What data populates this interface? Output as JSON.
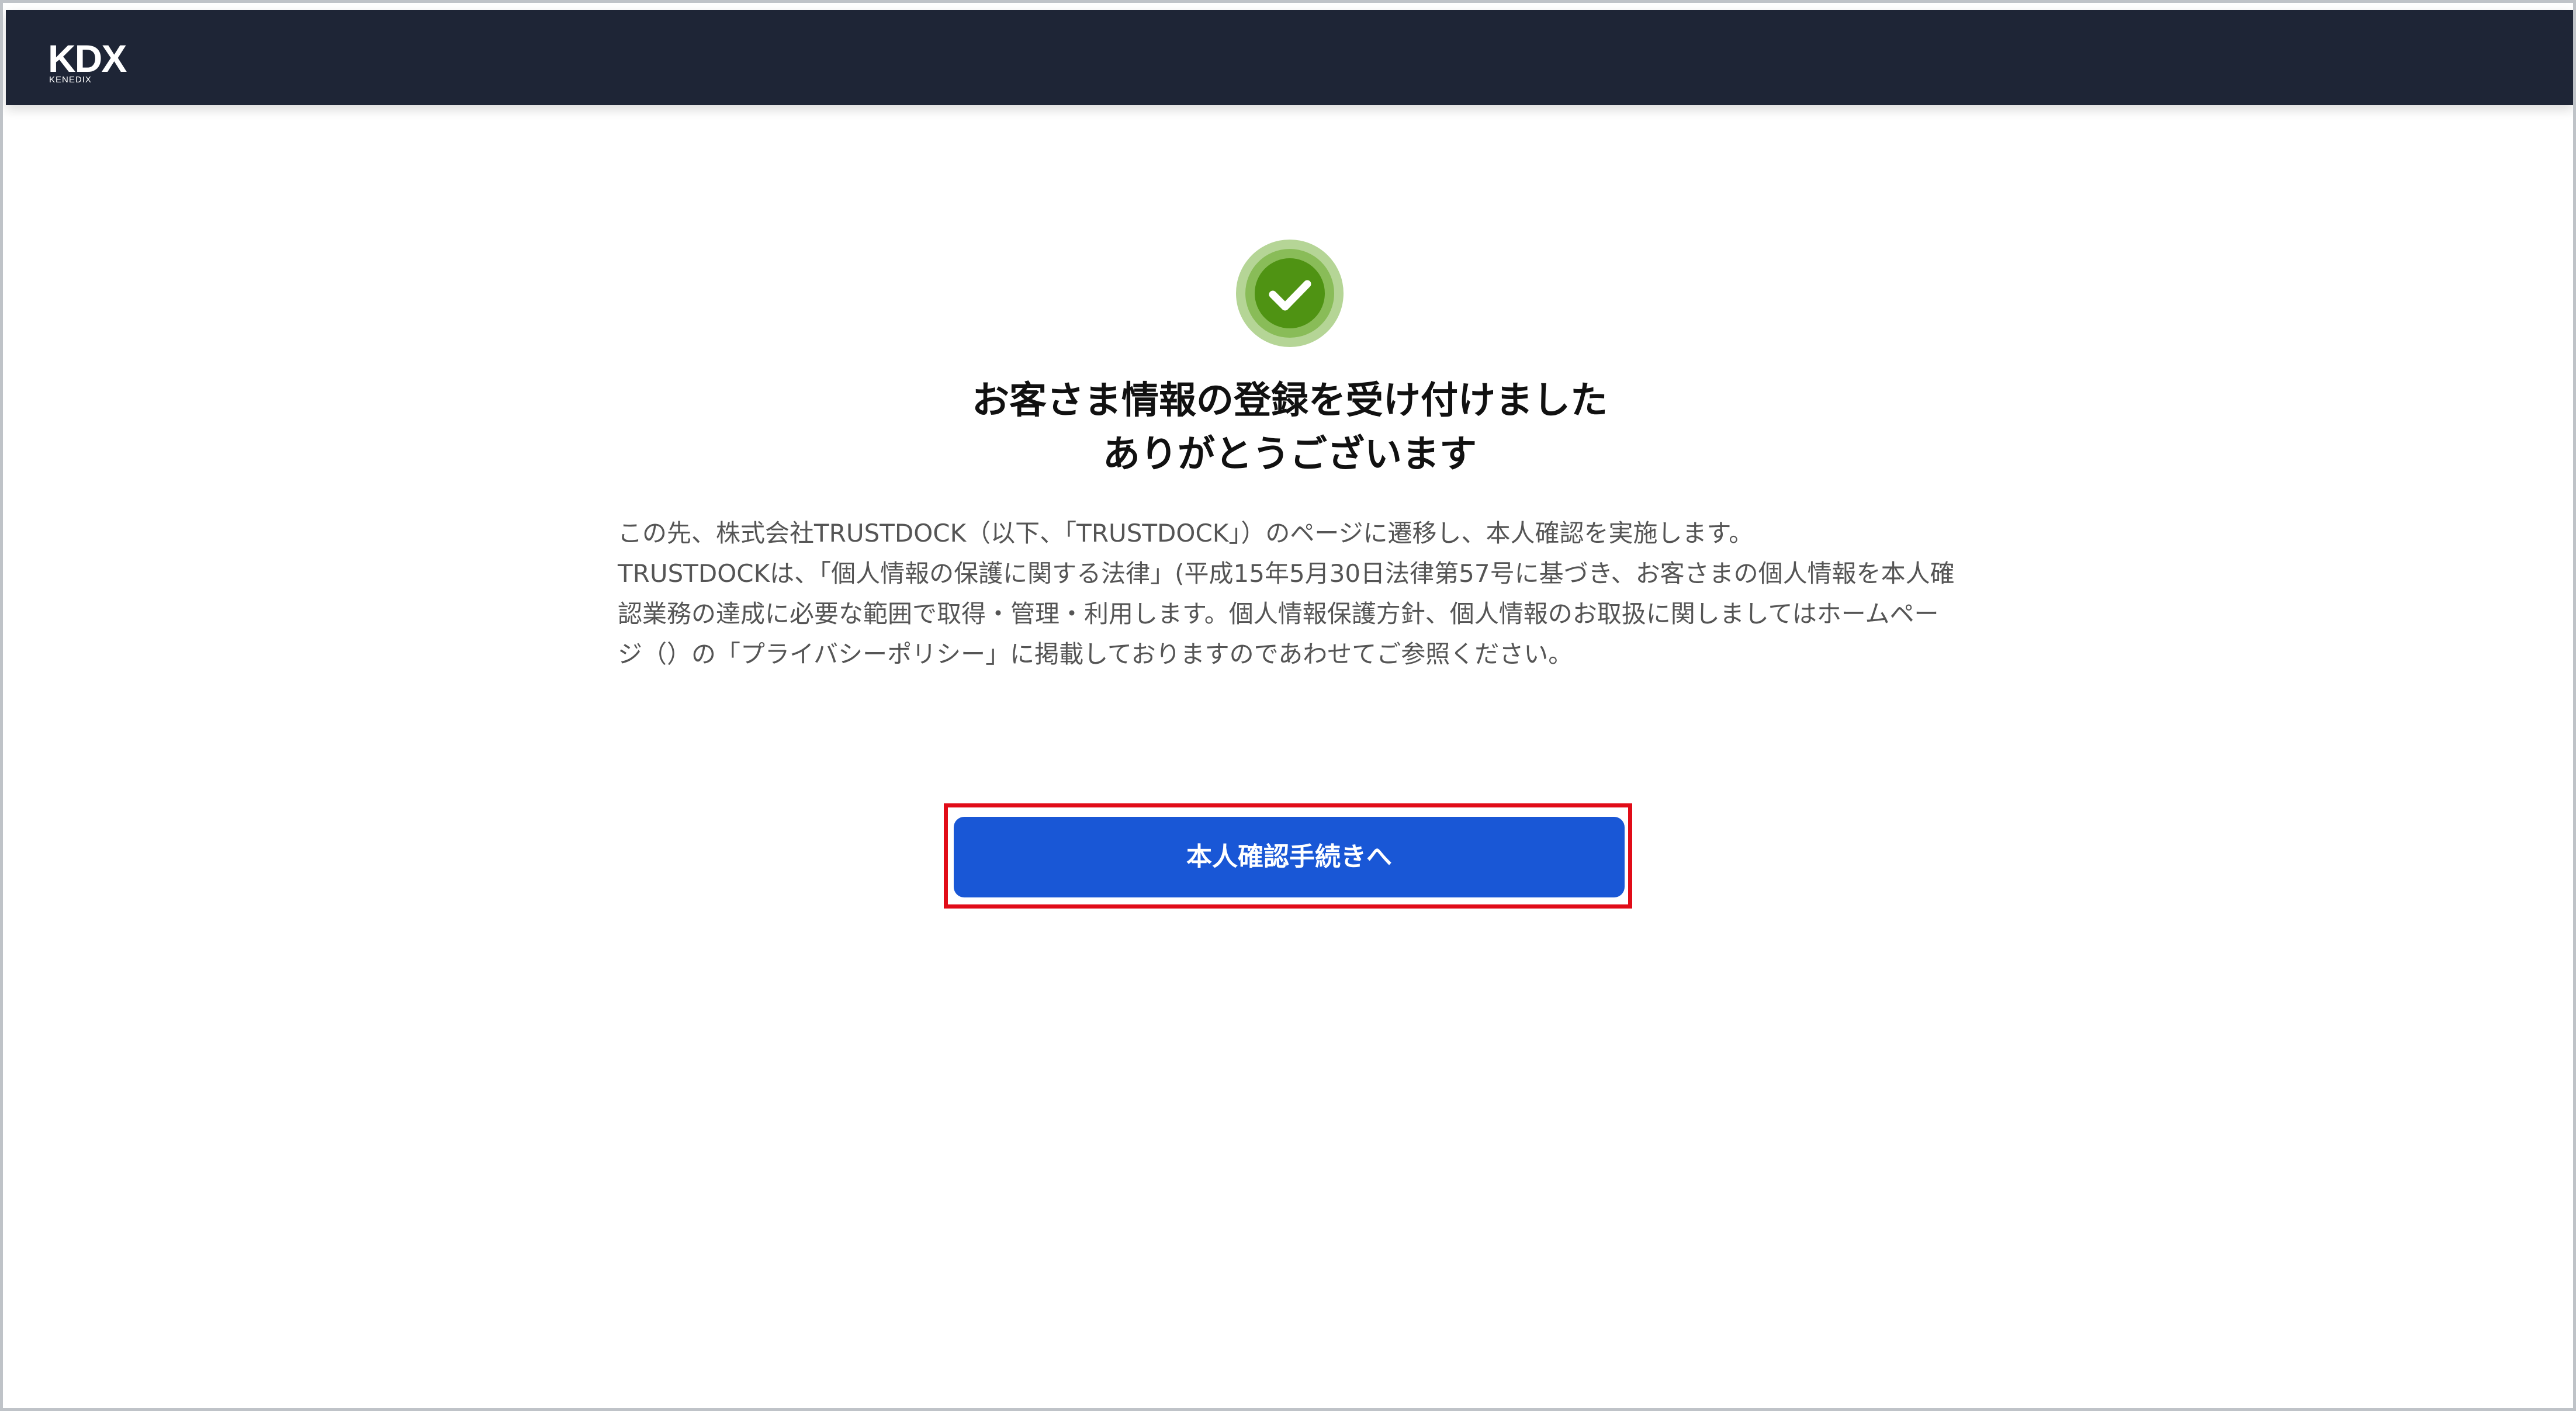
{
  "header": {
    "logo_text": "KDX",
    "logo_subtext": "KENEDIX"
  },
  "status": {
    "icon": "check-circle-icon",
    "color": "#4f9313"
  },
  "main": {
    "title_line1": "お客さま情報の登録を受け付けました",
    "title_line2": "ありがとうございます",
    "description": "この先、株式会社TRUSTDOCK（以下、「TRUSTDOCK」）のページに遷移し、本人確認を実施します。\nTRUSTDOCKは、「個人情報の保護に関する法律」(平成15年5月30日法律第57号に基づき、お客さまの個人情報を本人確認業務の達成に必要な範囲で取得・管理・利用します。個人情報保護方針、個人情報のお取扱に関しましてはホームページ（）の「プライバシーポリシー」に掲載しておりますのであわせてご参照ください。"
  },
  "action": {
    "button_label": "本人確認手続きへ",
    "button_color": "#1957d6",
    "highlight_color": "#e10c18"
  }
}
